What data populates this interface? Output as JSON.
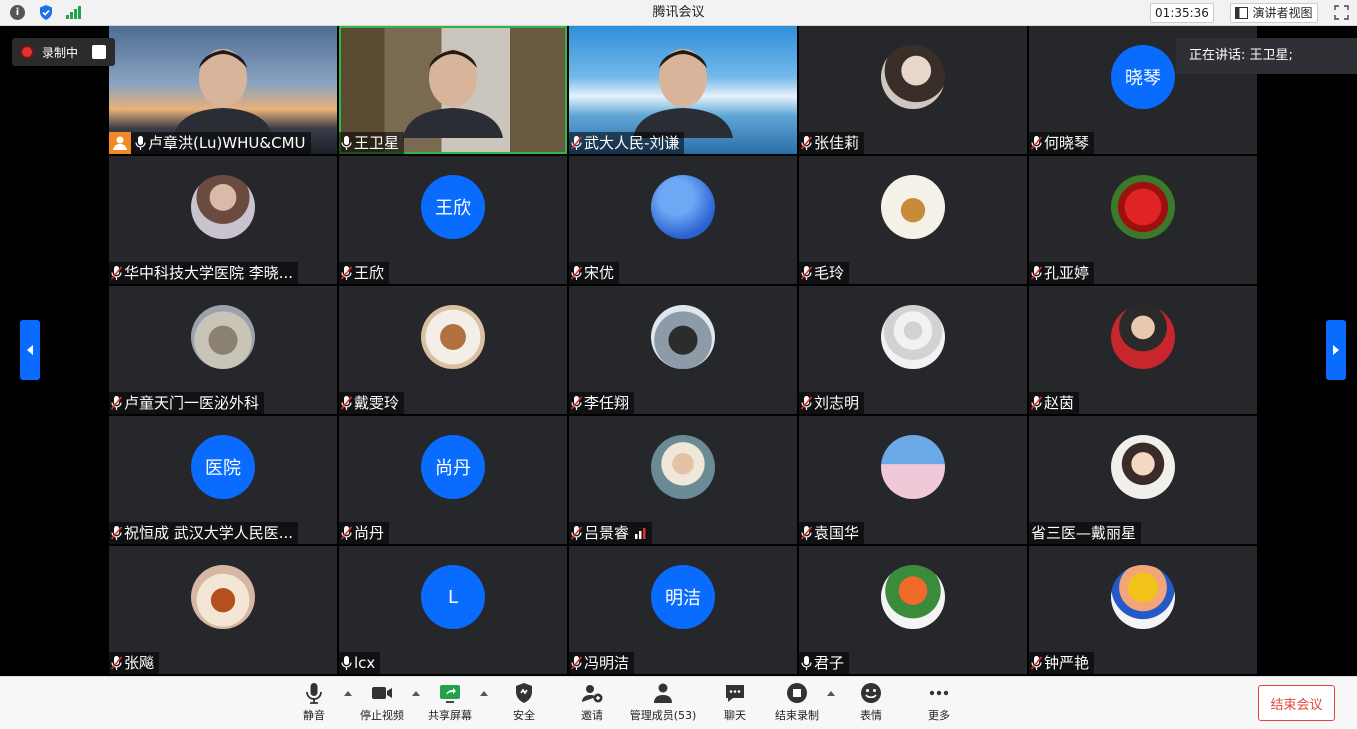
{
  "window": {
    "title": "腾讯会议",
    "timer": "01:35:36",
    "view_label": "演讲者视图"
  },
  "recording": {
    "label": "录制中"
  },
  "speaking": {
    "text": "正在讲话: 王卫星;"
  },
  "colors": {
    "accent": "#0a6cff",
    "active_border": "#2fb34a",
    "end_red": "#e0463b"
  },
  "participants": [
    {
      "name": "卢章洪(Lu)WHU&CMU",
      "avatar": "video-sunset",
      "mic": "on",
      "host": true
    },
    {
      "name": "王卫星",
      "avatar": "video-office",
      "mic": "on",
      "active": true
    },
    {
      "name": "武大人民-刘谦",
      "avatar": "video-sea",
      "mic": "off"
    },
    {
      "name": "张佳莉",
      "avatar": "photo-girl",
      "mic": "off"
    },
    {
      "name": "何晓琴",
      "avatar": "text",
      "avatar_text": "晓琴",
      "mic": "off"
    },
    {
      "name": "华中科技大学医院 李晓...",
      "avatar": "photo-woman",
      "mic": "off"
    },
    {
      "name": "王欣",
      "avatar": "text",
      "avatar_text": "王欣",
      "mic": "off"
    },
    {
      "name": "宋优",
      "avatar": "photo-sky",
      "mic": "off"
    },
    {
      "name": "毛玲",
      "avatar": "photo-toy",
      "mic": "off"
    },
    {
      "name": "孔亚婷",
      "avatar": "photo-strawberry",
      "mic": "off"
    },
    {
      "name": "卢童天门一医泌外科",
      "avatar": "photo-cat",
      "mic": "off"
    },
    {
      "name": "戴雯玲",
      "avatar": "photo-dog",
      "mic": "off"
    },
    {
      "name": "李任翔",
      "avatar": "photo-jeep",
      "mic": "off"
    },
    {
      "name": "刘志明",
      "avatar": "default-user",
      "mic": "off"
    },
    {
      "name": "赵茵",
      "avatar": "photo-wuhan",
      "mic": "off"
    },
    {
      "name": "祝恒成 武汉大学人民医...",
      "avatar": "text",
      "avatar_text": "医院",
      "mic": "off"
    },
    {
      "name": "尚丹",
      "avatar": "text",
      "avatar_text": "尚丹",
      "mic": "off"
    },
    {
      "name": "吕景睿",
      "avatar": "photo-hat",
      "mic": "off",
      "signal": true
    },
    {
      "name": "袁国华",
      "avatar": "photo-pink-lake",
      "mic": "off"
    },
    {
      "name": "省三医—戴丽星",
      "avatar": "cartoon-woman",
      "mic": "none"
    },
    {
      "name": "张飚",
      "avatar": "photo-tea",
      "mic": "off"
    },
    {
      "name": "lcx",
      "avatar": "text",
      "avatar_text": "L",
      "mic": "on"
    },
    {
      "name": "冯明洁",
      "avatar": "text",
      "avatar_text": "明洁",
      "mic": "off"
    },
    {
      "name": "君子",
      "avatar": "photo-flower",
      "mic": "on"
    },
    {
      "name": "钟严艳",
      "avatar": "photo-figure",
      "mic": "off"
    }
  ],
  "toolbar": {
    "mute": "静音",
    "stop_video": "停止视频",
    "share_screen": "共享屏幕",
    "security": "安全",
    "invite": "邀请",
    "members": "管理成员(53)",
    "chat": "聊天",
    "end_record": "结束录制",
    "reactions": "表情",
    "more": "更多",
    "end_meeting": "结束会议"
  }
}
